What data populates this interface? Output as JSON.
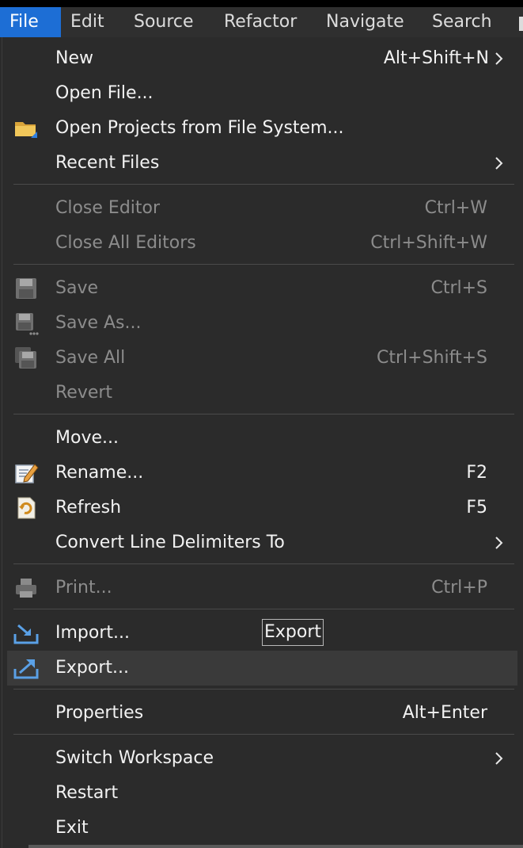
{
  "menubar": {
    "items": [
      {
        "label": "File"
      },
      {
        "label": "Edit"
      },
      {
        "label": "Source"
      },
      {
        "label": "Refactor"
      },
      {
        "label": "Navigate"
      },
      {
        "label": "Search"
      }
    ]
  },
  "menu": {
    "new": {
      "label": "New",
      "accel": "Alt+Shift+N"
    },
    "open_file": {
      "label": "Open File..."
    },
    "open_projects": {
      "label": "Open Projects from File System...",
      "icon": "folder-icon"
    },
    "recent_files": {
      "label": "Recent Files"
    },
    "close_editor": {
      "label": "Close Editor",
      "accel": "Ctrl+W"
    },
    "close_all_editors": {
      "label": "Close All Editors",
      "accel": "Ctrl+Shift+W"
    },
    "save": {
      "label": "Save",
      "accel": "Ctrl+S",
      "icon": "save-icon"
    },
    "save_as": {
      "label": "Save As...",
      "icon": "save-as-icon"
    },
    "save_all": {
      "label": "Save All",
      "accel": "Ctrl+Shift+S",
      "icon": "save-all-icon"
    },
    "revert": {
      "label": "Revert"
    },
    "move": {
      "label": "Move..."
    },
    "rename": {
      "label": "Rename...",
      "accel": "F2",
      "icon": "rename-icon"
    },
    "refresh": {
      "label": "Refresh",
      "accel": "F5",
      "icon": "refresh-icon"
    },
    "convert": {
      "label": "Convert Line Delimiters To"
    },
    "print": {
      "label": "Print...",
      "accel": "Ctrl+P",
      "icon": "print-icon"
    },
    "import": {
      "label": "Import...",
      "icon": "import-icon"
    },
    "export": {
      "label": "Export...",
      "icon": "export-icon"
    },
    "properties": {
      "label": "Properties",
      "accel": "Alt+Enter"
    },
    "switch_workspace": {
      "label": "Switch Workspace"
    },
    "restart": {
      "label": "Restart"
    },
    "exit": {
      "label": "Exit"
    }
  },
  "tooltip": {
    "text": "Export"
  },
  "colors": {
    "accent": "#1d6ed5",
    "menu_bg": "#2b2b2b",
    "hover_bg": "#3a3a3a",
    "disabled_text": "#8c8c8c"
  }
}
